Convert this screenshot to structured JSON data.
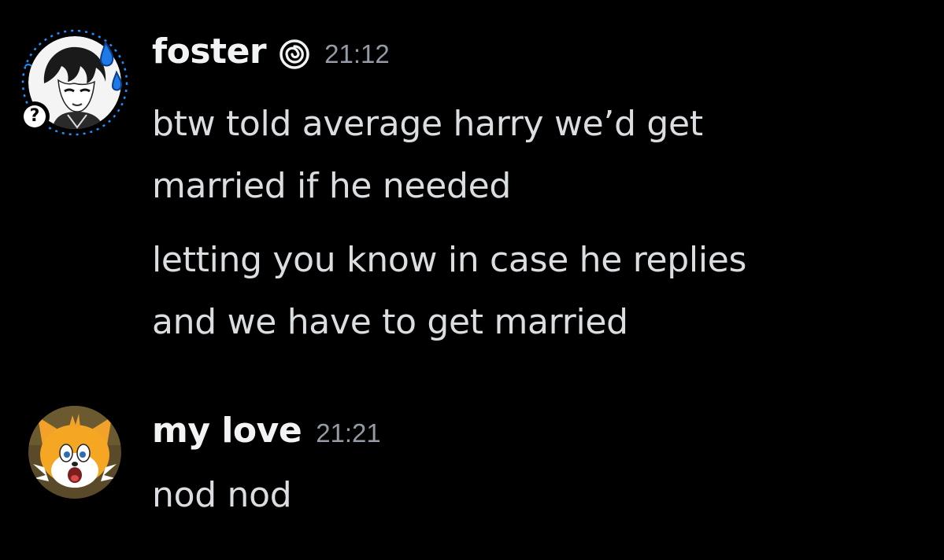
{
  "messages": [
    {
      "author": "foster",
      "author_badge_icon": "spiral-icon",
      "time": "21:12",
      "avatar_decoration_badge": "?",
      "lines": [
        "btw told average harry we’d get",
        "married if he needed",
        "letting you know in case he replies",
        "and we have to get married"
      ]
    },
    {
      "author": "my love",
      "time": "21:21",
      "lines": [
        "nod nod"
      ]
    }
  ],
  "colors": {
    "background": "#000000",
    "username": "#f2f3f5",
    "message_text": "#dbdee1",
    "timestamp": "#949ba4",
    "decoration_accent": "#1e90ff"
  }
}
